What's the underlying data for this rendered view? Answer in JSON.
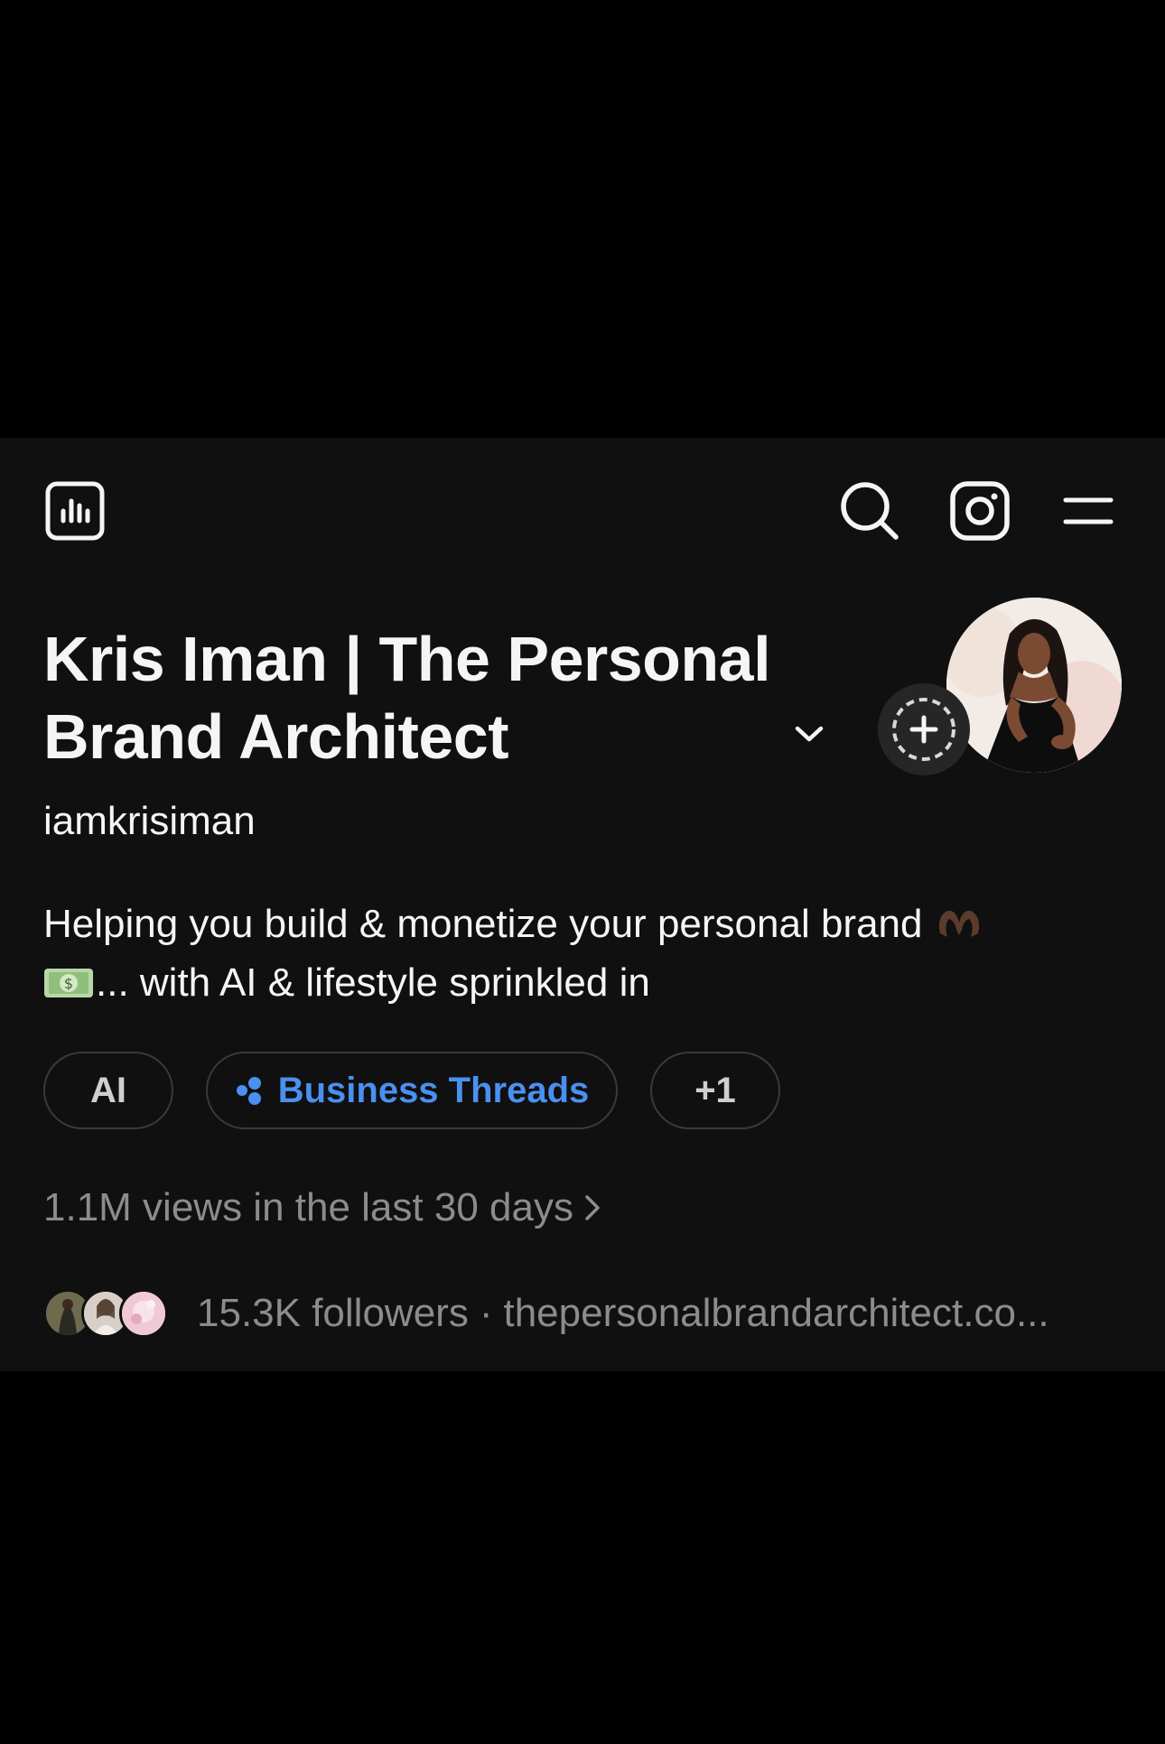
{
  "profile": {
    "name": "Kris Iman | The Personal Brand Architect",
    "username": "iamkrisiman",
    "bio_line1": "Helping you build & monetize your personal brand",
    "bio_line2": "... with AI & lifestyle sprinkled in"
  },
  "tags": [
    {
      "label": "AI"
    },
    {
      "label": "Business Threads"
    },
    {
      "label": "+1"
    }
  ],
  "stats": {
    "views": "1.1M views in the last 30 days",
    "followers": "15.3K followers",
    "separator": "·",
    "link": "thepersonalbrandarchitect.co..."
  },
  "icons": {
    "insights": "insights-icon",
    "search": "search-icon",
    "instagram": "instagram-icon",
    "menu": "menu-icon",
    "add_story": "add-story-icon",
    "chevron": "chevron-down-icon"
  },
  "colors": {
    "background": "#101010",
    "text": "#f5f5f5",
    "muted": "#8c8c8c",
    "accent": "#4a90f0"
  }
}
